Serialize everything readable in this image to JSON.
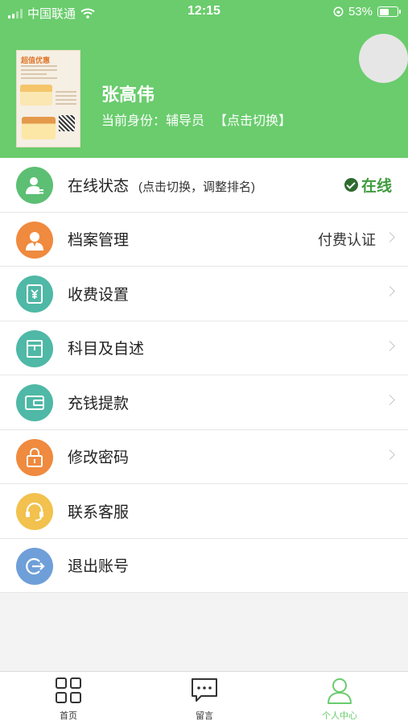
{
  "status_bar": {
    "carrier": "中国联通",
    "time": "12:15",
    "battery": "53%",
    "battery_level": 0.53
  },
  "profile": {
    "name": "张高伟",
    "role_label": "当前身份：",
    "role": "辅导员",
    "switch_label": "【点击切换】",
    "poster_title": "超值优惠"
  },
  "menu": {
    "items": [
      {
        "label": "在线状态",
        "hint": "(点击切换，调整排名)",
        "status": "在线",
        "icon": "user-status-icon",
        "color": "#5cbf73"
      },
      {
        "label": "档案管理",
        "value": "付费认证",
        "icon": "profile-file-icon",
        "color": "#ef8a3e"
      },
      {
        "label": "收费设置",
        "icon": "fee-settings-icon",
        "color": "#4fb8a6"
      },
      {
        "label": "科目及自述",
        "icon": "subject-book-icon",
        "color": "#4fb8a6"
      },
      {
        "label": "充钱提款",
        "icon": "wallet-icon",
        "color": "#4fb8a6"
      },
      {
        "label": "修改密码",
        "icon": "lock-icon",
        "color": "#ef8a3e"
      },
      {
        "label": "联系客服",
        "icon": "headset-icon",
        "color": "#f2c14e"
      },
      {
        "label": "退出账号",
        "icon": "logout-icon",
        "color": "#6f9fd8"
      }
    ]
  },
  "tabbar": {
    "tabs": [
      {
        "label": "首页",
        "icon": "grid-home-icon"
      },
      {
        "label": "留言",
        "icon": "message-bubble-icon"
      },
      {
        "label": "个人中心",
        "icon": "person-icon",
        "active": true
      }
    ]
  },
  "colors": {
    "brand_green": "#6acc6d",
    "online_green": "#3f9c3f",
    "background": "#f3f3f3"
  }
}
